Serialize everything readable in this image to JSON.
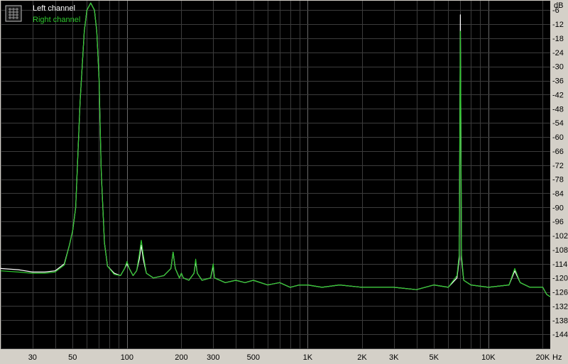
{
  "chart_data": {
    "type": "line",
    "xlabel": "Hz",
    "ylabel": "dB",
    "x_scale": "log",
    "xlim": [
      20,
      22000
    ],
    "ylim": [
      -150,
      -2
    ],
    "grid": true,
    "legend_position": "top-left",
    "x_ticks": [
      {
        "value": 30,
        "label": "30"
      },
      {
        "value": 50,
        "label": "50"
      },
      {
        "value": 100,
        "label": "100"
      },
      {
        "value": 200,
        "label": "200"
      },
      {
        "value": 300,
        "label": "300"
      },
      {
        "value": 500,
        "label": "500"
      },
      {
        "value": 1000,
        "label": "1K"
      },
      {
        "value": 2000,
        "label": "2K"
      },
      {
        "value": 3000,
        "label": "3K"
      },
      {
        "value": 5000,
        "label": "5K"
      },
      {
        "value": 10000,
        "label": "10K"
      },
      {
        "value": 20000,
        "label": "20K"
      }
    ],
    "y_ticks": [
      {
        "value": -6,
        "label": "-6"
      },
      {
        "value": -12,
        "label": "-12"
      },
      {
        "value": -18,
        "label": "-18"
      },
      {
        "value": -24,
        "label": "-24"
      },
      {
        "value": -30,
        "label": "-30"
      },
      {
        "value": -36,
        "label": "-36"
      },
      {
        "value": -42,
        "label": "-42"
      },
      {
        "value": -48,
        "label": "-48"
      },
      {
        "value": -54,
        "label": "-54"
      },
      {
        "value": -60,
        "label": "-60"
      },
      {
        "value": -66,
        "label": "-66"
      },
      {
        "value": -72,
        "label": "-72"
      },
      {
        "value": -78,
        "label": "-78"
      },
      {
        "value": -84,
        "label": "-84"
      },
      {
        "value": -90,
        "label": "-90"
      },
      {
        "value": -96,
        "label": "-96"
      },
      {
        "value": -102,
        "label": "-102"
      },
      {
        "value": -108,
        "label": "-108"
      },
      {
        "value": -114,
        "label": "-114"
      },
      {
        "value": -120,
        "label": "-120"
      },
      {
        "value": -126,
        "label": "-126"
      },
      {
        "value": -132,
        "label": "-132"
      },
      {
        "value": -138,
        "label": "-138"
      },
      {
        "value": -144,
        "label": "-144"
      }
    ],
    "series": [
      {
        "name": "Left channel",
        "color": "#ffffff",
        "points": [
          [
            20,
            -116
          ],
          [
            25,
            -116.5
          ],
          [
            30,
            -117.5
          ],
          [
            35,
            -117.5
          ],
          [
            40,
            -117
          ],
          [
            45,
            -114
          ],
          [
            48,
            -106
          ],
          [
            50,
            -100
          ],
          [
            52,
            -90
          ],
          [
            55,
            -45
          ],
          [
            58,
            -15
          ],
          [
            60,
            -6
          ],
          [
            63,
            -3
          ],
          [
            66,
            -6
          ],
          [
            68,
            -15
          ],
          [
            70,
            -35
          ],
          [
            72,
            -75
          ],
          [
            75,
            -105
          ],
          [
            78,
            -115
          ],
          [
            85,
            -118
          ],
          [
            92,
            -119
          ],
          [
            97,
            -116
          ],
          [
            100,
            -114
          ],
          [
            103,
            -116
          ],
          [
            108,
            -119
          ],
          [
            113,
            -117
          ],
          [
            117,
            -112
          ],
          [
            120,
            -106
          ],
          [
            123,
            -112
          ],
          [
            128,
            -118
          ],
          [
            140,
            -120
          ],
          [
            160,
            -119
          ],
          [
            175,
            -116
          ],
          [
            180,
            -109
          ],
          [
            185,
            -116
          ],
          [
            195,
            -120
          ],
          [
            200,
            -118
          ],
          [
            205,
            -120
          ],
          [
            220,
            -121
          ],
          [
            235,
            -118
          ],
          [
            240,
            -113
          ],
          [
            245,
            -118
          ],
          [
            260,
            -121
          ],
          [
            290,
            -120
          ],
          [
            300,
            -115
          ],
          [
            305,
            -120
          ],
          [
            350,
            -122
          ],
          [
            400,
            -121
          ],
          [
            450,
            -122
          ],
          [
            500,
            -121
          ],
          [
            600,
            -123
          ],
          [
            700,
            -122
          ],
          [
            800,
            -124
          ],
          [
            900,
            -123
          ],
          [
            1000,
            -123
          ],
          [
            1200,
            -124
          ],
          [
            1500,
            -123
          ],
          [
            2000,
            -124
          ],
          [
            2500,
            -124
          ],
          [
            3000,
            -124
          ],
          [
            4000,
            -125
          ],
          [
            5000,
            -123
          ],
          [
            6000,
            -124
          ],
          [
            6700,
            -120
          ],
          [
            6900,
            -112
          ],
          [
            7000,
            -8
          ],
          [
            7100,
            -112
          ],
          [
            7300,
            -121
          ],
          [
            8000,
            -123
          ],
          [
            10000,
            -124
          ],
          [
            13000,
            -123
          ],
          [
            14000,
            -117
          ],
          [
            15000,
            -122
          ],
          [
            17000,
            -124
          ],
          [
            20000,
            -124
          ],
          [
            21000,
            -127
          ],
          [
            22000,
            -128
          ]
        ]
      },
      {
        "name": "Right channel",
        "color": "#2ec82e",
        "points": [
          [
            20,
            -117
          ],
          [
            25,
            -117.5
          ],
          [
            30,
            -118
          ],
          [
            35,
            -118
          ],
          [
            40,
            -117.5
          ],
          [
            45,
            -114.5
          ],
          [
            48,
            -106
          ],
          [
            50,
            -100
          ],
          [
            52,
            -90
          ],
          [
            55,
            -45
          ],
          [
            58,
            -15
          ],
          [
            60,
            -6
          ],
          [
            63,
            -3
          ],
          [
            66,
            -6
          ],
          [
            68,
            -15
          ],
          [
            70,
            -35
          ],
          [
            72,
            -75
          ],
          [
            75,
            -105
          ],
          [
            78,
            -115
          ],
          [
            85,
            -118.5
          ],
          [
            92,
            -119
          ],
          [
            97,
            -116
          ],
          [
            100,
            -113
          ],
          [
            103,
            -116
          ],
          [
            108,
            -119
          ],
          [
            113,
            -117
          ],
          [
            117,
            -110
          ],
          [
            120,
            -104
          ],
          [
            123,
            -110
          ],
          [
            128,
            -118
          ],
          [
            140,
            -120
          ],
          [
            160,
            -119
          ],
          [
            175,
            -116
          ],
          [
            180,
            -109
          ],
          [
            185,
            -116
          ],
          [
            195,
            -120
          ],
          [
            200,
            -118
          ],
          [
            205,
            -120
          ],
          [
            220,
            -121
          ],
          [
            235,
            -118
          ],
          [
            240,
            -112
          ],
          [
            245,
            -118
          ],
          [
            260,
            -121
          ],
          [
            290,
            -120
          ],
          [
            300,
            -114
          ],
          [
            305,
            -120
          ],
          [
            350,
            -122
          ],
          [
            400,
            -121
          ],
          [
            450,
            -122
          ],
          [
            500,
            -121
          ],
          [
            600,
            -123
          ],
          [
            700,
            -122
          ],
          [
            800,
            -124
          ],
          [
            900,
            -123
          ],
          [
            1000,
            -123
          ],
          [
            1200,
            -124
          ],
          [
            1500,
            -123
          ],
          [
            2000,
            -124
          ],
          [
            2500,
            -124
          ],
          [
            3000,
            -124
          ],
          [
            4000,
            -125
          ],
          [
            5000,
            -123
          ],
          [
            6000,
            -124
          ],
          [
            6700,
            -119
          ],
          [
            6900,
            -110
          ],
          [
            7000,
            -15
          ],
          [
            7100,
            -110
          ],
          [
            7300,
            -121
          ],
          [
            8000,
            -123
          ],
          [
            10000,
            -124
          ],
          [
            13000,
            -123
          ],
          [
            14000,
            -116
          ],
          [
            15000,
            -122
          ],
          [
            17000,
            -124
          ],
          [
            20000,
            -124
          ],
          [
            21000,
            -127
          ],
          [
            22000,
            -128
          ]
        ]
      }
    ]
  }
}
